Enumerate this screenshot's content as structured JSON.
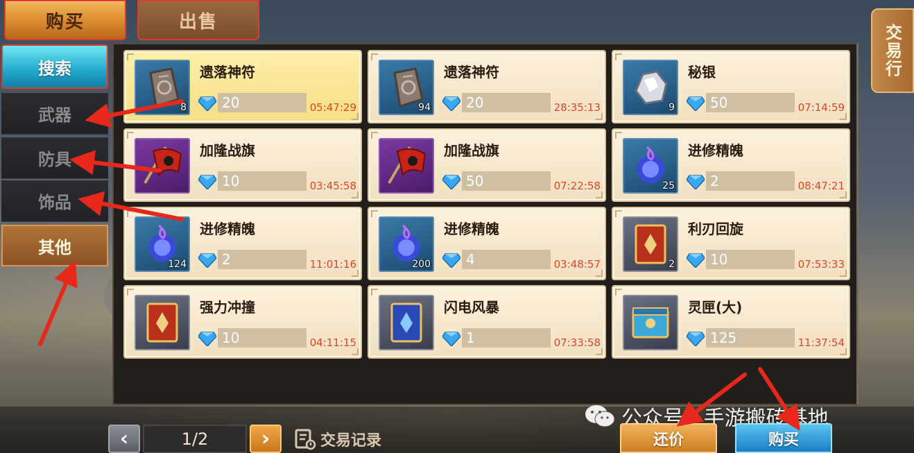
{
  "tabs": {
    "buy": "购买",
    "sell": "出售"
  },
  "side_tab_right": "交易行",
  "sidebar": {
    "search": "搜索",
    "categories": [
      {
        "label": "武器"
      },
      {
        "label": "防具"
      },
      {
        "label": "饰品"
      },
      {
        "label": "其他",
        "active": true
      }
    ]
  },
  "listings": [
    {
      "name": "遗落神符",
      "qty": "8",
      "price": "20",
      "time": "05:47:29",
      "icon": "rune-stone-icon",
      "selected": true
    },
    {
      "name": "遗落神符",
      "qty": "94",
      "price": "20",
      "time": "28:35:13",
      "icon": "rune-stone-icon"
    },
    {
      "name": "秘银",
      "qty": "9",
      "price": "50",
      "time": "07:14:59",
      "icon": "mithril-ore-icon"
    },
    {
      "name": "加隆战旗",
      "qty": "",
      "price": "10",
      "time": "03:45:58",
      "icon": "war-banner-icon"
    },
    {
      "name": "加隆战旗",
      "qty": "",
      "price": "50",
      "time": "07:22:58",
      "icon": "war-banner-icon"
    },
    {
      "name": "进修精魄",
      "qty": "25",
      "price": "2",
      "time": "08:47:21",
      "icon": "spirit-orb-icon"
    },
    {
      "name": "进修精魄",
      "qty": "124",
      "price": "2",
      "time": "11:01:16",
      "icon": "spirit-orb-icon"
    },
    {
      "name": "进修精魄",
      "qty": "200",
      "price": "4",
      "time": "03:48:57",
      "icon": "spirit-orb-icon"
    },
    {
      "name": "利刃回旋",
      "qty": "2",
      "price": "10",
      "time": "07:53:33",
      "icon": "skill-book-red-icon"
    },
    {
      "name": "强力冲撞",
      "qty": "",
      "price": "10",
      "time": "04:11:15",
      "icon": "skill-book-red-icon"
    },
    {
      "name": "闪电风暴",
      "qty": "",
      "price": "1",
      "time": "07:33:58",
      "icon": "skill-book-blue-icon"
    },
    {
      "name": "灵匣(大)",
      "qty": "",
      "price": "125",
      "time": "11:37:54",
      "icon": "spirit-chest-icon"
    }
  ],
  "pagination": {
    "indicator": "1/2",
    "prev": "‹",
    "next": "›"
  },
  "trade_record": "交易记录",
  "actions": {
    "bargain": "还价",
    "buy": "购买"
  },
  "watermark": "公众号 · 手游搬砖基地",
  "colors": {
    "price_text": "#ffffff",
    "timer": "#e0442a",
    "gem": "#3aa8f0"
  }
}
